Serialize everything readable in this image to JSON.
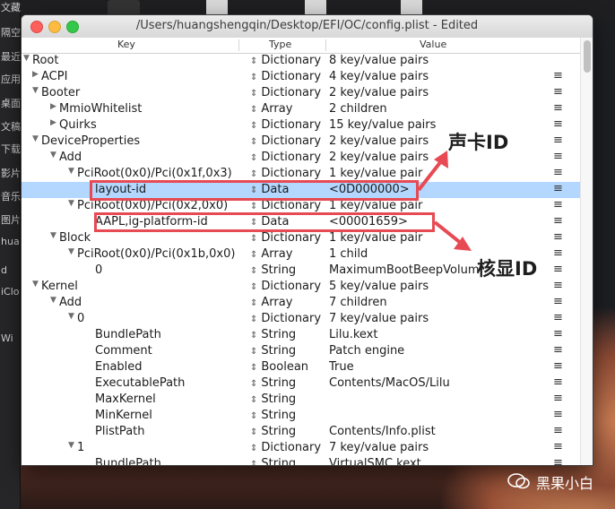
{
  "window": {
    "title": "/Users/huangshengqin/Desktop/EFI/OC/config.plist - Edited"
  },
  "columns": {
    "key": "Key",
    "type": "Type",
    "value": "Value"
  },
  "rows": [
    {
      "key": "Root",
      "type": "Dictionary",
      "value": "8 key/value pairs",
      "menu": false
    },
    {
      "key": "ACPI",
      "type": "Dictionary",
      "value": "4 key/value pairs",
      "menu": true
    },
    {
      "key": "Booter",
      "type": "Dictionary",
      "value": "2 key/value pairs",
      "menu": true
    },
    {
      "key": "MmioWhitelist",
      "type": "Array",
      "value": "2 children",
      "menu": true
    },
    {
      "key": "Quirks",
      "type": "Dictionary",
      "value": "15 key/value pairs",
      "menu": true
    },
    {
      "key": "DeviceProperties",
      "type": "Dictionary",
      "value": "2 key/value pairs",
      "menu": true
    },
    {
      "key": "Add",
      "type": "Dictionary",
      "value": "2 key/value pairs",
      "menu": true
    },
    {
      "key": "PciRoot(0x0)/Pci(0x1f,0x3)",
      "type": "Dictionary",
      "value": "1 key/value pair",
      "menu": true
    },
    {
      "key": "layout-id",
      "type": "Data",
      "value": "<0D000000>",
      "menu": true
    },
    {
      "key": "PciRoot(0x0)/Pci(0x2,0x0)",
      "type": "Dictionary",
      "value": "1 key/value pair",
      "menu": true
    },
    {
      "key": "AAPL,ig-platform-id",
      "type": "Data",
      "value": "<00001659>",
      "menu": true
    },
    {
      "key": "Block",
      "type": "Dictionary",
      "value": "1 key/value pair",
      "menu": true
    },
    {
      "key": "PciRoot(0x0)/Pci(0x1b,0x0)",
      "type": "Array",
      "value": "1 child",
      "menu": true
    },
    {
      "key": "0",
      "type": "String",
      "value": "MaximumBootBeepVolume",
      "menu": true
    },
    {
      "key": "Kernel",
      "type": "Dictionary",
      "value": "5 key/value pairs",
      "menu": true
    },
    {
      "key": "Add",
      "type": "Array",
      "value": "7 children",
      "menu": true
    },
    {
      "key": "0",
      "type": "Dictionary",
      "value": "7 key/value pairs",
      "menu": true
    },
    {
      "key": "BundlePath",
      "type": "String",
      "value": "Lilu.kext",
      "menu": true
    },
    {
      "key": "Comment",
      "type": "String",
      "value": "Patch engine",
      "menu": true
    },
    {
      "key": "Enabled",
      "type": "Boolean",
      "value": "True",
      "menu": true
    },
    {
      "key": "ExecutablePath",
      "type": "String",
      "value": "Contents/MacOS/Lilu",
      "menu": true
    },
    {
      "key": "MaxKernel",
      "type": "String",
      "value": "",
      "menu": true
    },
    {
      "key": "MinKernel",
      "type": "String",
      "value": "",
      "menu": true
    },
    {
      "key": "PlistPath",
      "type": "String",
      "value": "Contents/Info.plist",
      "menu": true
    },
    {
      "key": "1",
      "type": "Dictionary",
      "value": "7 key/value pairs",
      "menu": true
    },
    {
      "key": "BundlePath",
      "type": "String",
      "value": "VirtualSMC.kext",
      "menu": true
    }
  ],
  "annotations": {
    "sound_id": "声卡ID",
    "igpu_id": "核显ID"
  },
  "sidebar_strip": [
    "文藏",
    "隔空",
    "最近",
    "应用",
    "桌面",
    "文稿",
    "下载",
    "影片",
    "音乐",
    "图片",
    "hua",
    "d",
    "iClo",
    "Wi"
  ],
  "watermark": "黑果小白"
}
